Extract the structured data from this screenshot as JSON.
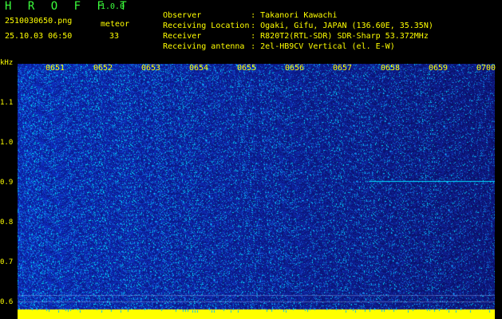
{
  "header": {
    "app_title": "H R O F F T",
    "version": "1.0.0",
    "file_name": "2510030650.png",
    "meteor_label": "meteor",
    "date_time": "25.10.03 06:50",
    "meteor_count": "33"
  },
  "info": [
    {
      "key": "Observer",
      "value": ": Takanori Kawachi"
    },
    {
      "key": "Receiving Location",
      "value": ": Ogaki, Gifu, JAPAN (136.60E, 35.35N)"
    },
    {
      "key": "Receiver",
      "value": ": R820T2(RTL-SDR) SDR-Sharp 53.372MHz"
    },
    {
      "key": "Receiving antenna",
      "value": ": 2el-HB9CV Vertical (el. E-W)"
    }
  ],
  "axis": {
    "y_unit": "kHz",
    "y_ticks": [
      "1.1",
      "1.0",
      "0.9",
      "0.8",
      "0.7",
      "0.6"
    ],
    "x_ticks": [
      "0651",
      "0652",
      "0653",
      "0654",
      "0655",
      "0656",
      "0657",
      "0658",
      "0659",
      "0700"
    ]
  },
  "colors": {
    "header_green": "#3cff3c",
    "header_yellow": "#ffff00",
    "spectrogram_base": "#1a3cc8",
    "signal_cyan": "#00e0ff",
    "noise_floor": "#ffff00"
  }
}
